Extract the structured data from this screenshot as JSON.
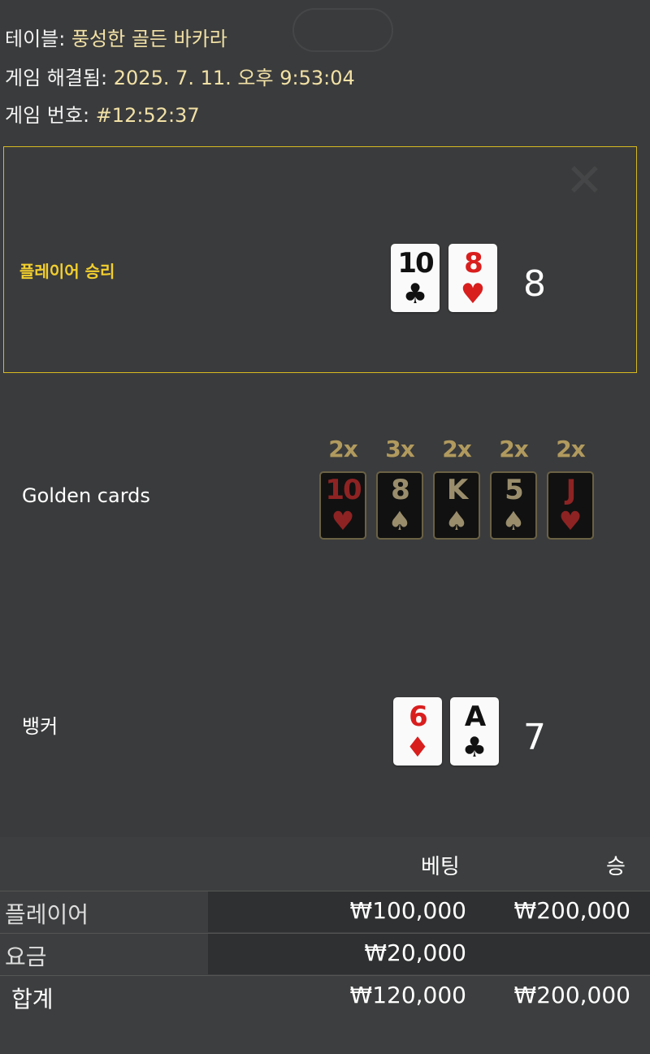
{
  "info": {
    "table_label": "테이블:",
    "table_name": "풍성한 골든 바카라",
    "resolved_label": "게임 해결됨:",
    "resolved_time": "2025. 7. 11. 오후 9:53:04",
    "game_no_label": "게임 번호:",
    "game_no": "#12:52:37"
  },
  "player": {
    "result": "플레이어 승리",
    "score": "8",
    "cards": [
      {
        "rank": "10",
        "suit": "♣",
        "color": "black"
      },
      {
        "rank": "8",
        "suit": "♥",
        "color": "red"
      }
    ]
  },
  "golden": {
    "label": "Golden cards",
    "cards": [
      {
        "mult": "2x",
        "rank": "10",
        "suit": "♥",
        "kind": "heart"
      },
      {
        "mult": "3x",
        "rank": "8",
        "suit": "♠",
        "kind": "spade"
      },
      {
        "mult": "2x",
        "rank": "K",
        "suit": "♠",
        "kind": "spade"
      },
      {
        "mult": "2x",
        "rank": "5",
        "suit": "♠",
        "kind": "spade"
      },
      {
        "mult": "2x",
        "rank": "J",
        "suit": "♥",
        "kind": "heart"
      }
    ]
  },
  "banker": {
    "label": "뱅커",
    "score": "7",
    "cards": [
      {
        "rank": "6",
        "suit": "♦",
        "color": "red"
      },
      {
        "rank": "A",
        "suit": "♣",
        "color": "black"
      }
    ]
  },
  "bets": {
    "headers": {
      "bet": "베팅",
      "win": "승"
    },
    "rows": [
      {
        "label": "플레이어",
        "bet": "₩100,000",
        "win": "₩200,000"
      },
      {
        "label": "요금",
        "bet": "₩20,000",
        "win": ""
      },
      {
        "label": "합계",
        "bet": "₩120,000",
        "win": "₩200,000"
      }
    ]
  },
  "colors": {
    "accent": "#d7b921",
    "value_text": "#f2e1a6",
    "red_suit": "#d91e1e",
    "golden_mult": "#b19a5e"
  }
}
